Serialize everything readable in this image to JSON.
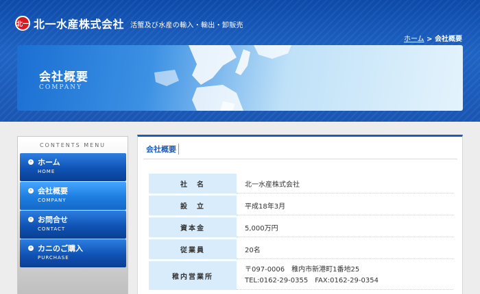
{
  "header": {
    "logo_mark": "北一",
    "company_name": "北一水産株式会社",
    "tagline": "活蟹及び水産の輸入・輸出・卸販売",
    "breadcrumb_home": "ホーム",
    "breadcrumb_sep": " > ",
    "breadcrumb_current": "会社概要"
  },
  "banner": {
    "title": "会社概要",
    "subtitle": "COMPANY"
  },
  "sidebar": {
    "title": "CONTENTS MENU",
    "items": [
      {
        "jp": "ホーム",
        "en": "HOME"
      },
      {
        "jp": "会社概要",
        "en": "COMPANY"
      },
      {
        "jp": "お問合せ",
        "en": "CONTACT"
      },
      {
        "jp": "カニのご購入",
        "en": "PURCHASE"
      }
    ]
  },
  "main": {
    "heading": "会社概要",
    "rows": [
      {
        "label": "社　名",
        "value": "北一水産株式会社"
      },
      {
        "label": "設　立",
        "value": "平成18年3月"
      },
      {
        "label": "資本金",
        "value": "5,000万円"
      },
      {
        "label": "従業員",
        "value": "20名"
      },
      {
        "label": "稚内営業所",
        "value_line1": "〒097-0006　稚内市新港町1番地25",
        "value_line2": "TEL:0162-29-0355　FAX:0162-29-0354"
      }
    ]
  },
  "colors": {
    "brand_blue": "#1a5bbb",
    "header_blue": "#0d4aa9",
    "label_bg": "#d9ecfb",
    "logo_red": "#d71921"
  }
}
